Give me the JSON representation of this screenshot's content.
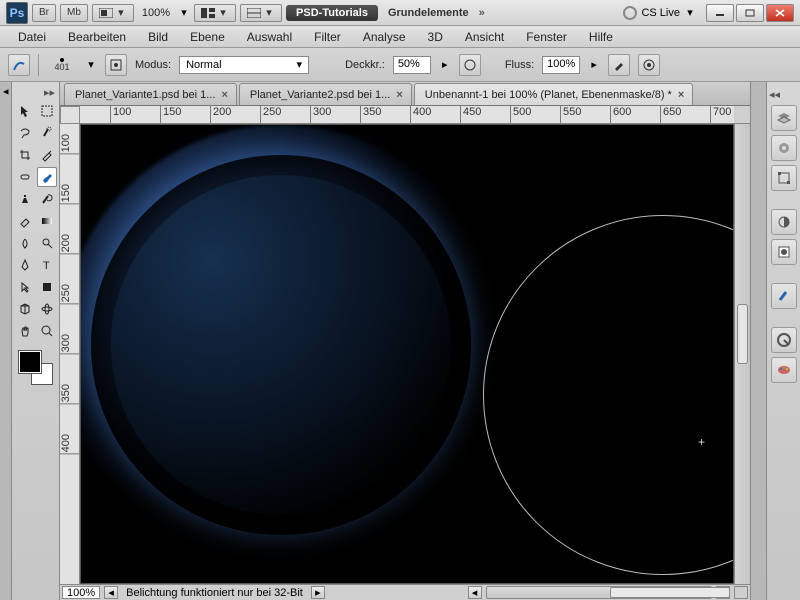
{
  "titlebar": {
    "app_abbrev": "Ps",
    "chips": {
      "br": "Br",
      "mb": "Mb"
    },
    "zoom": "100%",
    "workspace_pill": "PSD-Tutorials",
    "doc_label": "Grundelemente",
    "cslive": "CS Live"
  },
  "menu": [
    "Datei",
    "Bearbeiten",
    "Bild",
    "Ebene",
    "Auswahl",
    "Filter",
    "Analyse",
    "3D",
    "Ansicht",
    "Fenster",
    "Hilfe"
  ],
  "options": {
    "brush_size": "401",
    "mode_label": "Modus:",
    "mode_value": "Normal",
    "opacity_label": "Deckkr.:",
    "opacity_value": "50%",
    "flow_label": "Fluss:",
    "flow_value": "100%"
  },
  "tabs": [
    {
      "label": "Planet_Variante1.psd bei 1..."
    },
    {
      "label": "Planet_Variante2.psd bei 1..."
    },
    {
      "label": "Unbenannt-1 bei 100% (Planet, Ebenenmaske/8) *"
    }
  ],
  "ruler_h": [
    "100",
    "150",
    "200",
    "250",
    "300",
    "350",
    "400",
    "450",
    "500",
    "550",
    "600",
    "650",
    "700"
  ],
  "ruler_v": [
    "100",
    "150",
    "200",
    "250",
    "300",
    "350",
    "400"
  ],
  "statusbar": {
    "zoom": "100%",
    "info": "Belichtung funktioniert nur bei 32-Bit"
  },
  "tool_names": [
    [
      "move-tool",
      "marquee-tool"
    ],
    [
      "lasso-tool",
      "quick-select-tool"
    ],
    [
      "crop-tool",
      "eyedropper-tool"
    ],
    [
      "healing-brush-tool",
      "brush-tool"
    ],
    [
      "clone-stamp-tool",
      "history-brush-tool"
    ],
    [
      "eraser-tool",
      "gradient-tool"
    ],
    [
      "blur-tool",
      "dodge-tool"
    ],
    [
      "pen-tool",
      "type-tool"
    ],
    [
      "path-select-tool",
      "shape-tool"
    ],
    [
      "3d-rotate-tool",
      "3d-orbit-tool"
    ],
    [
      "hand-tool",
      "zoom-tool"
    ]
  ],
  "dock_icons": [
    "layers-panel-icon",
    "channels-panel-icon",
    "paths-panel-icon",
    "adjustments-panel-icon",
    "styles-panel-icon",
    "brush-presets-panel-icon",
    "swatches-panel-icon",
    "color-panel-icon",
    "history-panel-icon"
  ]
}
